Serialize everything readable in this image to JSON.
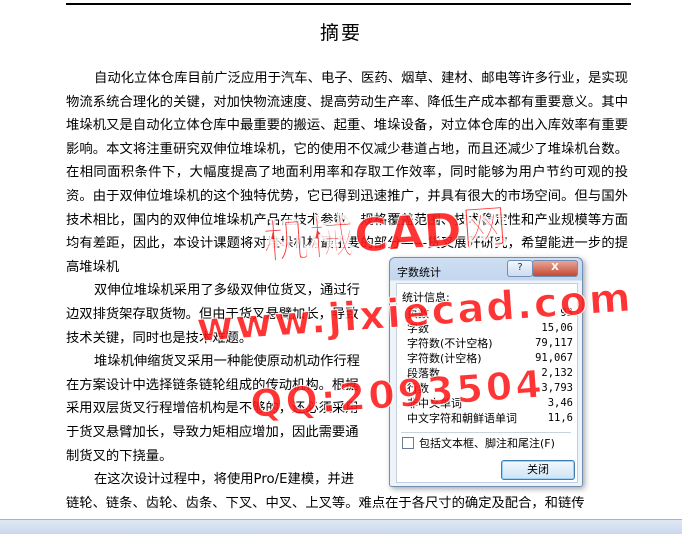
{
  "document": {
    "title": "摘要",
    "paragraphs": [
      "自动化立体仓库目前广泛应用于汽车、电子、医药、烟草、建材、邮电等许多行业，是实现物流系统合理化的关键，对加快物流速度、提高劳动生产率、降低生产成本都有重要意义。其中堆垛机又是自动化立体仓库中最重要的搬运、起重、堆垛设备，对立体仓库的出入库效率有重要影响。本文将注重研究双伸位堆垛机，它的使用不仅减少巷道占地，而且还减少了堆垛机台数。在相同面积条件下，大幅度提高了地面利用率和存取工作效率，同时能够为用户节约可观的投资。由于双伸位堆垛机的这个独特优势，它已得到迅速推广，并具有很大的市场空间。但与国外技术相比，国内的双伸位堆垛机产品在技术参数、规格覆盖范围、技术稳定性和产业规模等方面均有差距，因此，本设计课题将对堆垛机构最主要的部分——货叉展开研究，希望能进一步的提高堆垛机",
      "双伸位堆垛机采用了多级双伸位货叉，通过行",
      "边双排货架存取货物。但由于货叉悬臂加长，导致",
      "技术关键，同时也是技术难题。",
      "堆垛机伸缩货叉采用一种能使原动机动作行程",
      "在方案设计中选择链条链轮组成的传动机构。根据",
      "采用双层货叉行程增倍机构是不够的，还必须采用",
      "于货叉悬臂加长，导致力矩相应增加，因此需要通",
      "制货叉的下挠量。",
      "在这次设计过程中，将使用Pro/E建模，并进",
      "链轮、链条、齿轮、齿条、下叉、中叉、上叉等。难点在于各尺寸的确定及配合，和链传"
    ]
  },
  "watermark": {
    "line1": "机械CAD网",
    "line2": "www.jixiecad.com",
    "line3": "QQ:2093504"
  },
  "dialog": {
    "title": "字数统计",
    "help_label": "?",
    "close_label": "X",
    "group_label": "统计信息:",
    "stats": [
      {
        "label": "页数",
        "value": "93"
      },
      {
        "label": "字数",
        "value": "15,06"
      },
      {
        "label": "字符数(不计空格)",
        "value": "79,117"
      },
      {
        "label": "字符数(计空格)",
        "value": "91,067"
      },
      {
        "label": "段落数",
        "value": "2,132"
      },
      {
        "label": "行数",
        "value": "3,793"
      },
      {
        "label": "非中文单词",
        "value": "3,46"
      },
      {
        "label": "中文字符和朝鲜语单词",
        "value": "11,6"
      }
    ],
    "checkbox_label": "包括文本框、脚注和尾注(F)",
    "checkbox_checked": false,
    "ok_label": "关闭"
  }
}
